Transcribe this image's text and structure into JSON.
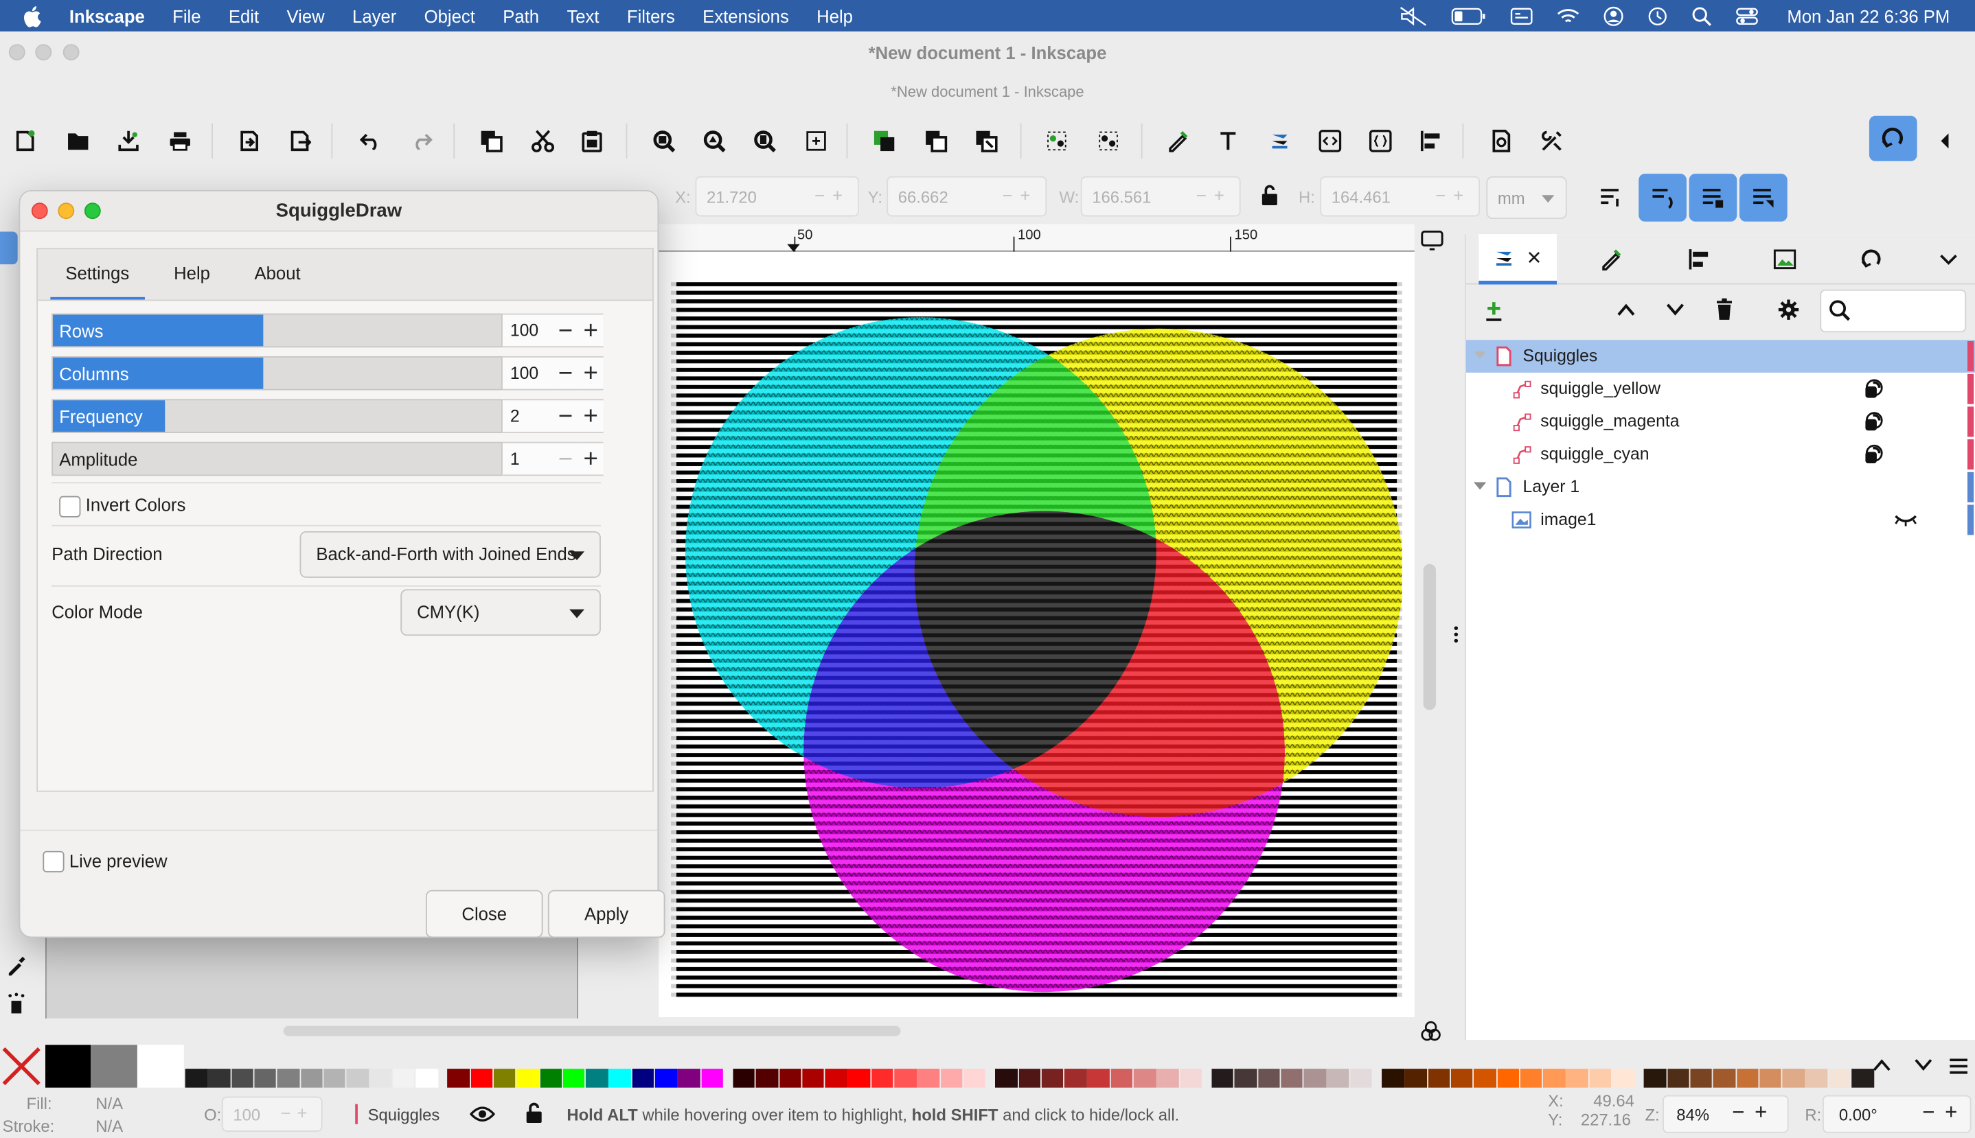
{
  "menubar": {
    "app_name": "Inkscape",
    "items": [
      "File",
      "Edit",
      "View",
      "Layer",
      "Object",
      "Path",
      "Text",
      "Filters",
      "Extensions",
      "Help"
    ],
    "clock": "Mon Jan 22  6:36 PM"
  },
  "window": {
    "title": "*New document 1 - Inkscape",
    "subtitle": "*New document 1 - Inkscape"
  },
  "tool_controls": {
    "x_label": "X:",
    "x_value": "21.720",
    "y_label": "Y:",
    "y_value": "66.662",
    "w_label": "W:",
    "w_value": "166.561",
    "h_label": "H:",
    "h_value": "164.461",
    "unit": "mm"
  },
  "ruler": {
    "ticks": [
      "50",
      "100",
      "150"
    ]
  },
  "layers_panel": {
    "rows": [
      {
        "label": "Squiggles",
        "type": "layer",
        "selected": true,
        "strip_color": "#e0476a"
      },
      {
        "label": "squiggle_yellow",
        "type": "path",
        "strip_color": "#e0476a"
      },
      {
        "label": "squiggle_magenta",
        "type": "path",
        "strip_color": "#e0476a"
      },
      {
        "label": "squiggle_cyan",
        "type": "path",
        "strip_color": "#e0476a"
      },
      {
        "label": "Layer 1",
        "type": "layer",
        "strip_color": "#5a87d1"
      },
      {
        "label": "image1",
        "type": "image",
        "strip_color": "#5a87d1"
      }
    ]
  },
  "dialog": {
    "title": "SquiggleDraw",
    "tabs": [
      "Settings",
      "Help",
      "About"
    ],
    "active_tab": "Settings",
    "sliders": [
      {
        "label": "Rows",
        "value": "100",
        "fraction": 0.47
      },
      {
        "label": "Columns",
        "value": "100",
        "fraction": 0.47
      },
      {
        "label": "Frequency",
        "value": "2",
        "fraction": 0.25
      },
      {
        "label": "Amplitude",
        "value": "1",
        "fraction": 0.0
      }
    ],
    "invert_colors_label": "Invert Colors",
    "invert_colors_checked": false,
    "path_direction_label": "Path Direction",
    "path_direction_value": "Back-and-Forth with Joined Ends",
    "color_mode_label": "Color Mode",
    "color_mode_value": "CMY(K)",
    "live_preview_label": "Live preview",
    "live_preview_checked": false,
    "close_label": "Close",
    "apply_label": "Apply"
  },
  "statusbar": {
    "fill_label": "Fill:",
    "fill_value": "N/A",
    "stroke_label": "Stroke:",
    "stroke_value": "N/A",
    "opacity_label": "O:",
    "opacity_value": "100",
    "layer_name": "Squiggles",
    "hint_part1": "Hold ALT",
    "hint_part2": " while hovering over item to highlight, ",
    "hint_part3": "hold SHIFT",
    "hint_part4": " and click to hide/lock all.",
    "x_label": "X:",
    "x_value": "49.64",
    "y_label": "Y:",
    "y_value": "227.16",
    "zoom_label": "Z:",
    "zoom_value": "84%",
    "rotate_label": "R:",
    "rotate_value": "0.00°"
  },
  "colors": {
    "menubar": "#2d5ea6",
    "accent": "#3b84dc",
    "cyan": "#00e5ee",
    "yellow": "#f5f500",
    "magenta": "#f000f0",
    "green": "#1fdc2c",
    "red": "#ee1a1a",
    "blue": "#2020e0",
    "black": "#1a1a1a"
  }
}
